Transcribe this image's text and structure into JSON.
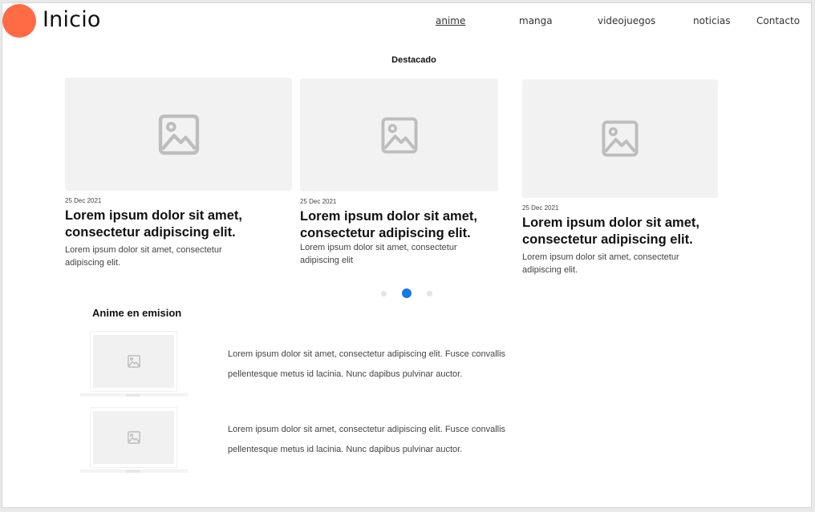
{
  "header": {
    "brand": "Inicio",
    "nav": [
      {
        "label": "anime",
        "active": true
      },
      {
        "label": "manga",
        "active": false
      },
      {
        "label": "videojuegos",
        "active": false
      },
      {
        "label": "noticias",
        "active": false
      },
      {
        "label": "Contacto",
        "active": false
      }
    ]
  },
  "featured": {
    "heading": "Destacado",
    "cards": [
      {
        "date": "25 Dec 2021",
        "title": "Lorem ipsum dolor sit amet, consectetur adipiscing elit.",
        "description": "Lorem ipsum dolor sit amet, consectetur adipiscing elit.",
        "image_icon": "image-placeholder-icon"
      },
      {
        "date": "25 Dec 2021",
        "title": "Lorem ipsum dolor sit amet, consectetur adipiscing elit.",
        "description": "Lorem ipsum dolor sit amet, consectetur adipiscing elit",
        "image_icon": "image-placeholder-icon"
      },
      {
        "date": "25 Dec 2021",
        "title": "Lorem ipsum dolor sit amet, consectetur adipiscing elit.",
        "description": "Lorem ipsum dolor sit amet, consectetur adipiscing elit.",
        "image_icon": "image-placeholder-icon"
      }
    ],
    "carousel": {
      "pages": 3,
      "active_index": 1
    }
  },
  "on_air": {
    "heading": "Anime en emision",
    "items": [
      {
        "text": "Lorem ipsum dolor sit amet, consectetur adipiscing elit. Fusce convallis pellentesque metus id lacinia. Nunc dapibus pulvinar auctor.",
        "image_icon": "image-placeholder-icon"
      },
      {
        "text": "Lorem ipsum dolor sit amet, consectetur adipiscing elit. Fusce convallis pellentesque metus id lacinia. Nunc dapibus pulvinar auctor.",
        "image_icon": "image-placeholder-icon"
      }
    ]
  },
  "colors": {
    "logo": "#ff6b45",
    "accent": "#1778e4",
    "placeholder": "#f2f2f2"
  }
}
